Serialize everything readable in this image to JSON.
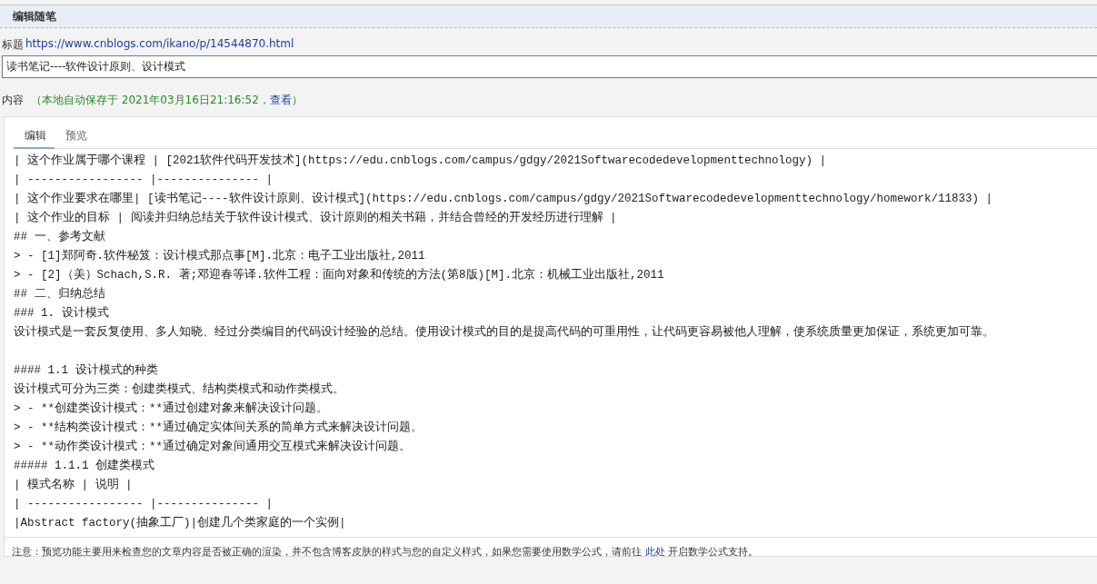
{
  "header": {
    "title": "编辑随笔"
  },
  "title_field": {
    "label": "标题",
    "url": "https://www.cnblogs.com/ikano/p/14544870.html",
    "value": "读书笔记----软件设计原则、设计模式"
  },
  "content": {
    "label": "内容",
    "autosave_prefix": "（本地自动保存于 2021年03月16日21:16:52，",
    "view_link": "查看",
    "autosave_suffix": "）"
  },
  "tabs": [
    {
      "label": "编辑",
      "selected": true
    },
    {
      "label": "预览",
      "selected": false
    }
  ],
  "editor_lines": [
    {
      "kind": "text",
      "text": "| 这个作业属于哪个课程 | [2021软件代码开发技术](https://edu.cnblogs.com/campus/gdgy/2021Softwarecodedevelopmenttechnology) |"
    },
    {
      "kind": "text",
      "text": "| ----------------- |--------------- |"
    },
    {
      "kind": "text",
      "text": "| 这个作业要求在哪里| [读书笔记----软件设计原则、设计模式](https://edu.cnblogs.com/campus/gdgy/2021Softwarecodedevelopmenttechnology/homework/11833) |"
    },
    {
      "kind": "text",
      "text": "| 这个作业的目标 | 阅读并归纳总结关于软件设计模式、设计原则的相关书籍，并结合曾经的开发经历进行理解 |"
    },
    {
      "kind": "text",
      "text": "## 一、参考文献"
    },
    {
      "kind": "text",
      "text": "> - [1]郑阿奇.软件秘笈：设计模式那点事[M].北京：电子工业出版社,2011"
    },
    {
      "kind": "text",
      "text": "> - [2]（美）Schach,S.R. 著;邓迎春等译.软件工程：面向对象和传统的方法(第8版)[M].北京：机械工业出版社,2011"
    },
    {
      "kind": "text",
      "text": "## 二、归纳总结"
    },
    {
      "kind": "text",
      "text": "### 1. 设计模式"
    },
    {
      "kind": "text",
      "text": "设计模式是一套反复使用、多人知晓、经过分类编目的代码设计经验的总结。使用设计模式的目的是提高代码的可重用性，让代码更容易被他人理解，使系统质量更加保证，系统更加可靠。"
    },
    {
      "kind": "blank"
    },
    {
      "kind": "text",
      "text": "#### 1.1 设计模式的种类"
    },
    {
      "kind": "text",
      "text": "设计模式可分为三类：创建类模式、结构类模式和动作类模式。"
    },
    {
      "kind": "text",
      "text": "> - **创建类设计模式：**通过创建对象来解决设计问题。"
    },
    {
      "kind": "text",
      "text": "> - **结构类设计模式：**通过确定实体间关系的简单方式来解决设计问题。"
    },
    {
      "kind": "text",
      "text": "> - **动作类设计模式：**通过确定对象间通用交互模式来解决设计问题。"
    },
    {
      "kind": "text",
      "text": "##### 1.1.1 创建类模式"
    },
    {
      "kind": "text",
      "text": "| 模式名称 | 说明 |"
    },
    {
      "kind": "text",
      "text": "| ----------------- |--------------- |"
    },
    {
      "kind": "text",
      "text": "|Abstract factory(抽象工厂)|创建几个类家庭的一个实例|"
    }
  ],
  "note": {
    "before": "注意：预览功能主要用来检查您的文章内容是否被正确的渲染，并不包含博客皮肤的样式与您的自定义样式，如果您需要使用数学公式，请前往 ",
    "link": "此处",
    "after": " 开启数学公式支持。"
  }
}
